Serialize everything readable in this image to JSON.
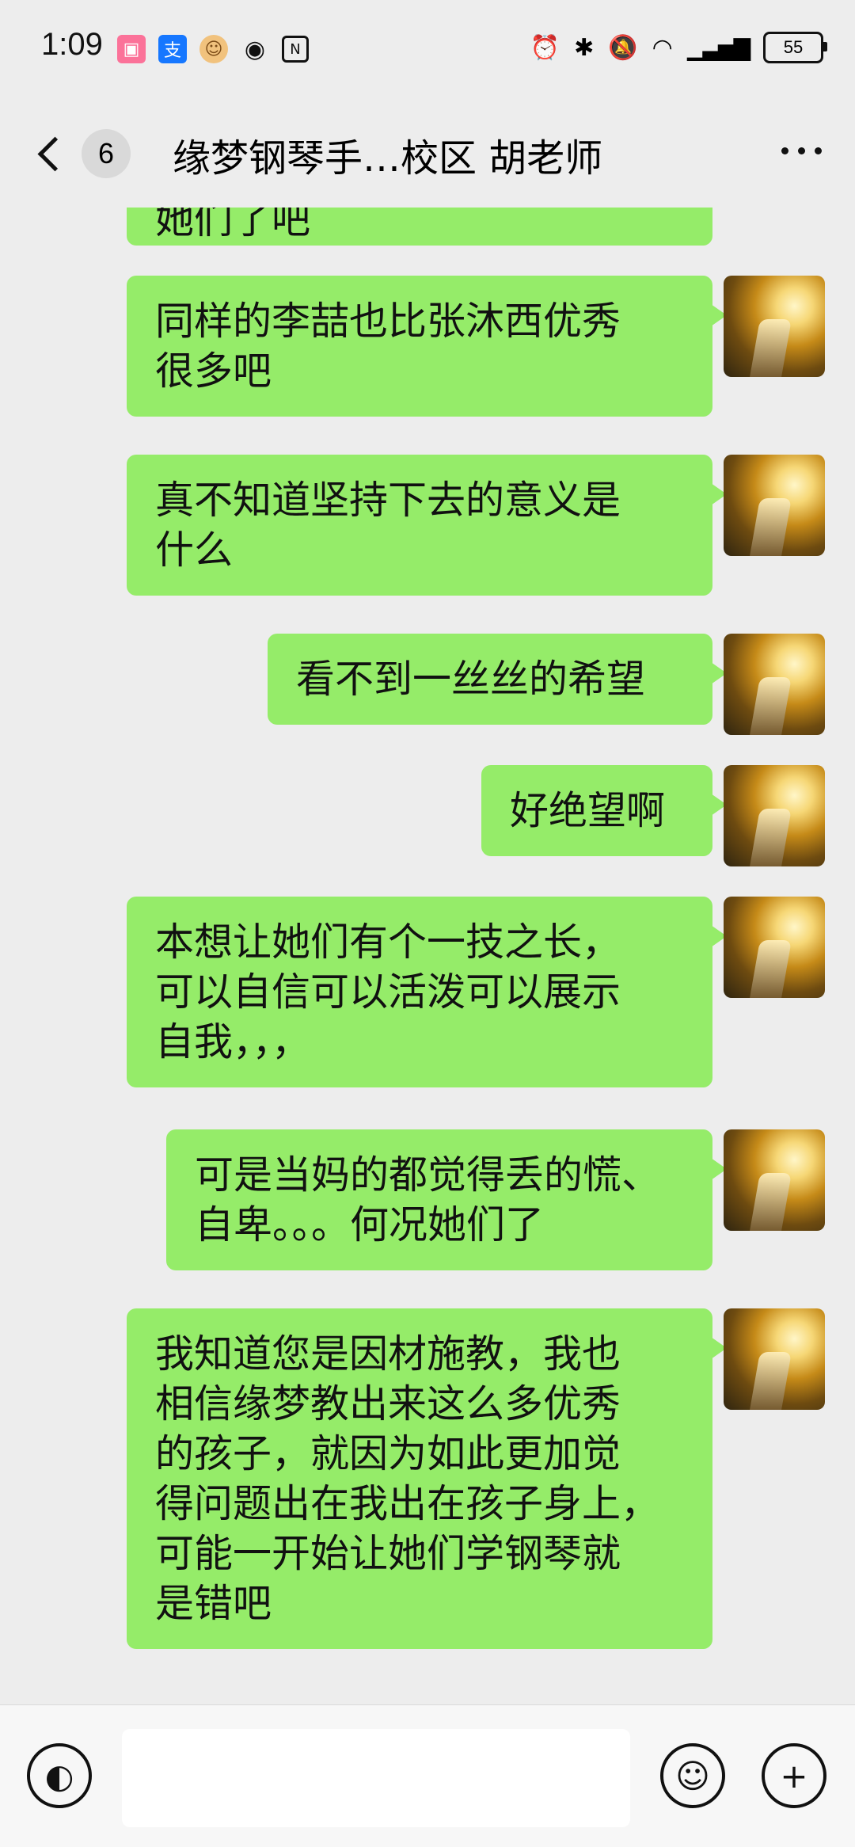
{
  "status_bar": {
    "time": "1:09",
    "battery": "55",
    "app_icons": [
      "bilibili-icon",
      "alipay-icon",
      "monkey-app-icon",
      "eye-icon",
      "nfc-icon"
    ],
    "system_icons": [
      "alarm-icon",
      "bluetooth-icon",
      "mute-icon",
      "wifi-icon",
      "signal-icon"
    ]
  },
  "header": {
    "unread_count": "6",
    "title": "缘梦钢琴手…校区 胡老师"
  },
  "messages": [
    {
      "lines": [
        "她们了吧"
      ],
      "partial": true
    },
    {
      "lines": [
        "同样的李喆也比张沐西优秀",
        "很多吧"
      ]
    },
    {
      "lines": [
        "真不知道坚持下去的意义是",
        "什么"
      ]
    },
    {
      "lines": [
        "看不到一丝丝的希望"
      ]
    },
    {
      "lines": [
        "好绝望啊"
      ]
    },
    {
      "lines": [
        "本想让她们有个一技之长，",
        "可以自信可以活泼可以展示",
        "自我，，，"
      ]
    },
    {
      "lines": [
        "可是当妈的都觉得丢的慌、",
        "自卑。。。何况她们了"
      ]
    },
    {
      "lines": [
        "我知道您是因材施教，我也",
        "相信缘梦教出来这么多优秀",
        "的孩子，就因为如此更加觉",
        "得问题出在我出在孩子身上，",
        "可能一开始让她们学钢琴就",
        "是错吧"
      ]
    }
  ],
  "input_bar": {
    "placeholder": "",
    "voice_icon": "voice-icon",
    "emoji_icon": "emoji-icon",
    "plus_icon": "plus-icon"
  },
  "colors": {
    "background": "#EDEDED",
    "bubble": "#95EC69",
    "input_bar": "#F7F7F7"
  }
}
